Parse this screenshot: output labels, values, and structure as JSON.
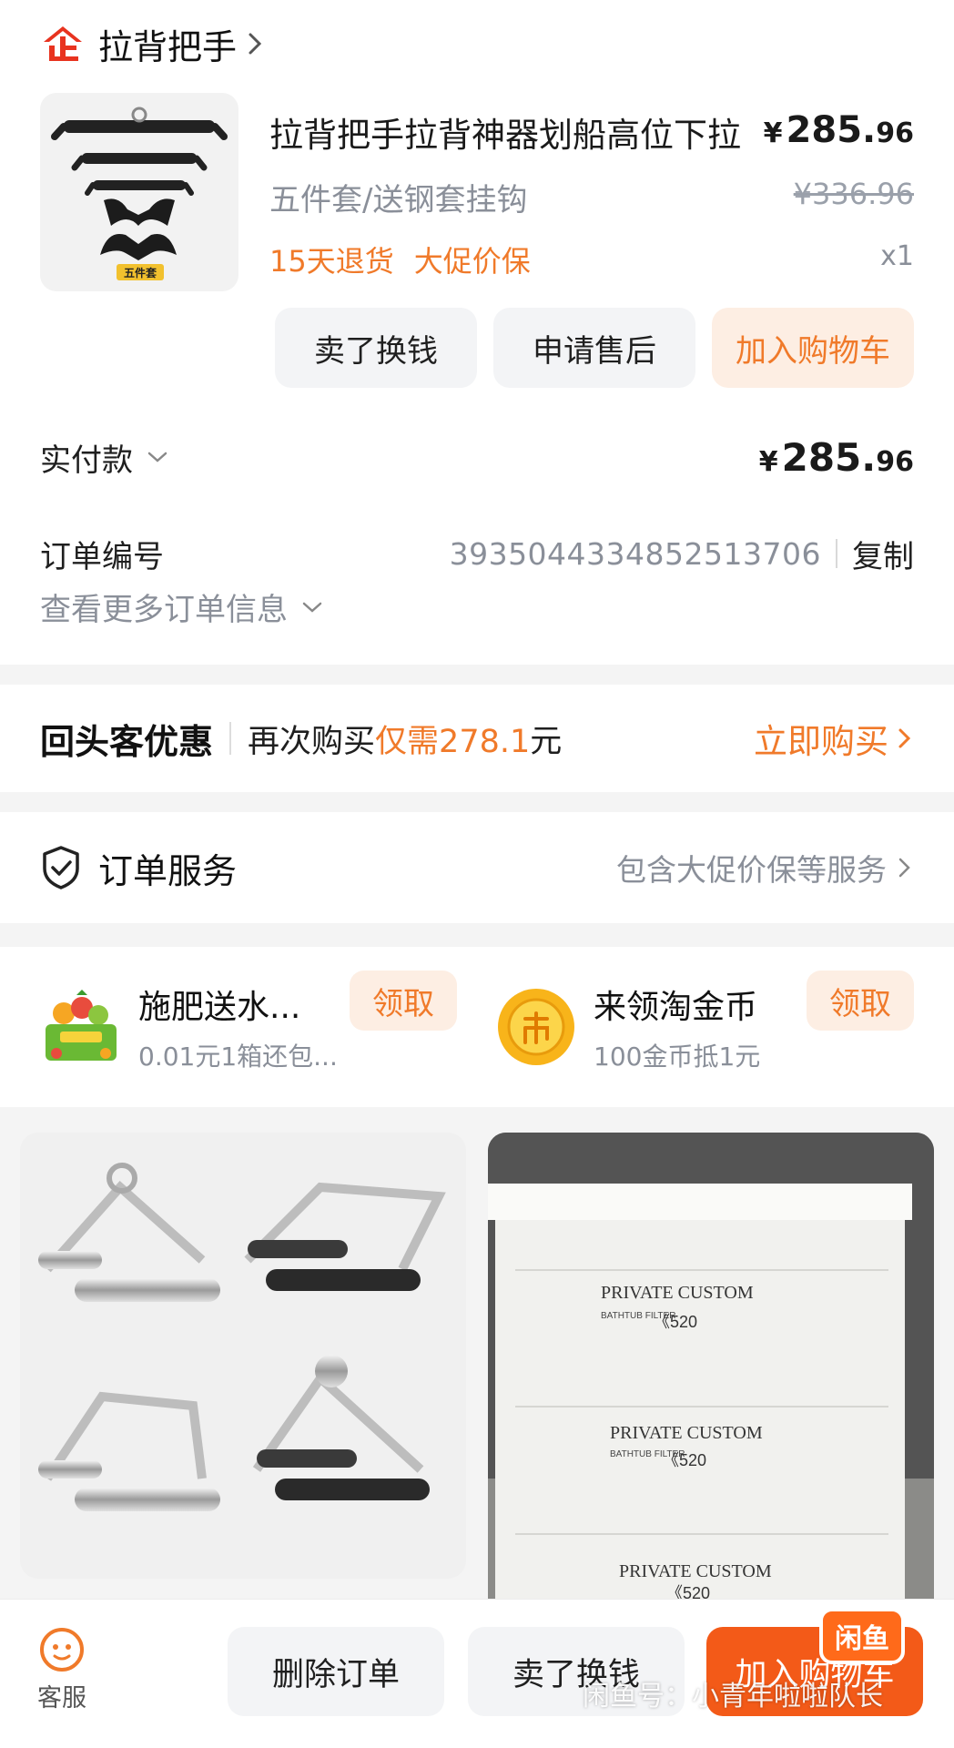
{
  "shop": {
    "name": "拉背把手"
  },
  "product": {
    "title": "拉背把手拉背神器划船高位下拉",
    "price_currency": "¥",
    "price_int": "285.",
    "price_dec": "96",
    "sku": "五件套/送钢套挂钩",
    "original_price": "¥336.96",
    "tags": [
      "15天退货",
      "大促价保"
    ],
    "quantity": "x1",
    "thumb_badge": "五件套"
  },
  "actions": {
    "sell": "卖了换钱",
    "after_sale": "申请售后",
    "add_cart": "加入购物车"
  },
  "payment": {
    "label": "实付款",
    "currency": "¥",
    "amount_int": "285.",
    "amount_dec": "96"
  },
  "order": {
    "label": "订单编号",
    "number": "3935044334852513706",
    "copy": "复制",
    "more": "查看更多订单信息"
  },
  "return_customer": {
    "title": "回头客优惠",
    "text_before": "再次购买",
    "highlight_prefix": "仅需",
    "amount": "278.1",
    "unit": "元",
    "buy": "立即购买"
  },
  "service": {
    "title": "订单服务",
    "summary": "包含大促价保等服务"
  },
  "promos": [
    {
      "title": "施肥送水...",
      "subtitle": "0.01元1箱还包...",
      "button": "领取"
    },
    {
      "title": "来领淘金币",
      "subtitle": "100金币抵1元",
      "button": "领取"
    }
  ],
  "feed": [
    {
      "text": []
    },
    {
      "text": [
        "PRIVATE CUSTOM",
        "BATHTUB FILTER",
        "《520"
      ]
    }
  ],
  "bottom": {
    "customer_service": "客服",
    "delete": "删除订单",
    "sell": "卖了换钱",
    "add_cart": "加入购物车"
  },
  "watermark": {
    "logo": "闲鱼",
    "text": "闲鱼号：小青年啦啦队长"
  },
  "colors": {
    "accent": "#f07a2a",
    "primary_button": "#f35a18",
    "muted": "#8a8f99",
    "light_accent_bg": "#fdeee3"
  }
}
